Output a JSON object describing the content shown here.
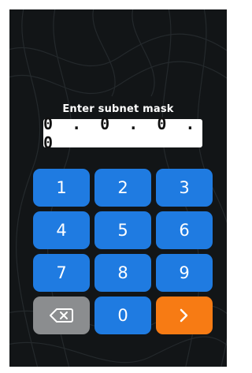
{
  "prompt": "Enter subnet mask",
  "input": {
    "value": "0 . 0 . 0 . 0"
  },
  "keys": {
    "k1": "1",
    "k2": "2",
    "k3": "3",
    "k4": "4",
    "k5": "5",
    "k6": "6",
    "k7": "7",
    "k8": "8",
    "k9": "9",
    "k0": "0"
  },
  "icons": {
    "backspace": "backspace-icon",
    "next": "chevron-right-icon"
  },
  "colors": {
    "background": "#121517",
    "key": "#1f7be1",
    "backspace_key": "#8b8d8f",
    "next_key": "#f77b14",
    "text": "#ffffff"
  }
}
